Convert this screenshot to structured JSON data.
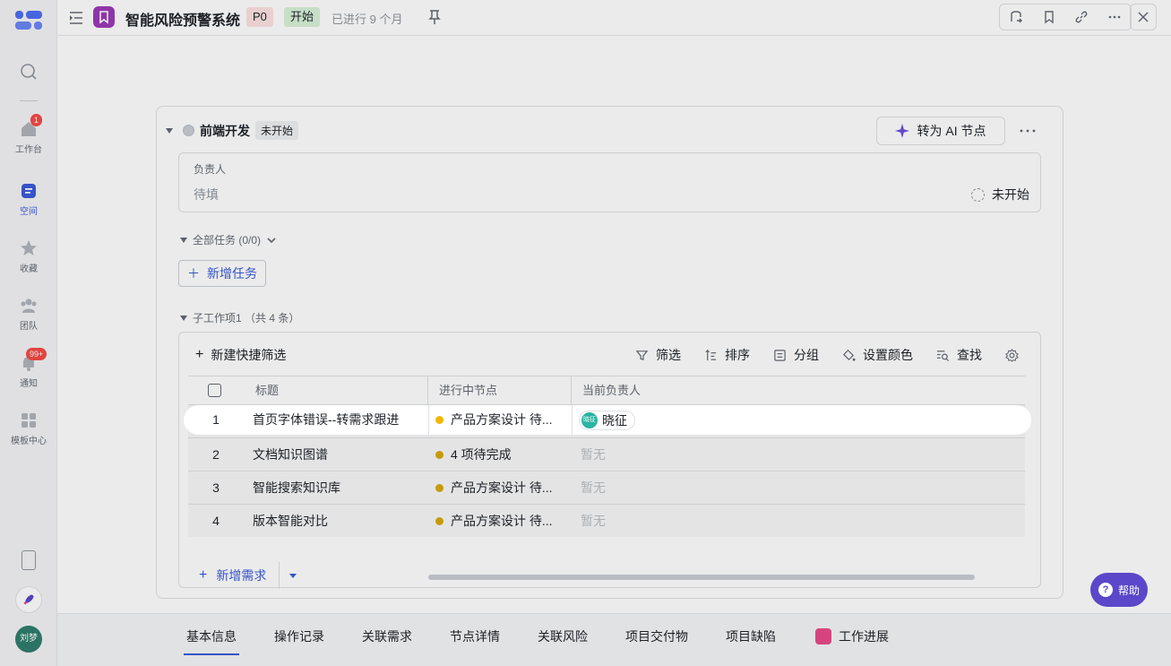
{
  "rail": {
    "items": [
      {
        "label": "工作台",
        "badge": "1"
      },
      {
        "label": "空间"
      },
      {
        "label": "收藏"
      },
      {
        "label": "团队"
      },
      {
        "label": "通知",
        "badge": "99+"
      },
      {
        "label": "模板中心"
      }
    ],
    "user_avatar": "刘梦"
  },
  "header": {
    "title": "智能风险预警系统",
    "priority": "P0",
    "status": "开始",
    "elapsed": "已进行 9 个月"
  },
  "node": {
    "name": "前端开发",
    "status": "未开始",
    "ai_button": "转为 AI 节点",
    "owner_label": "负责人",
    "owner_value": "待填",
    "owner_status": "未开始"
  },
  "tasks": {
    "section_title": "全部任务 (0/0)",
    "add_button": "新增任务"
  },
  "subitems": {
    "section_title": "子工作项1 （共 4 条）",
    "toolbar": {
      "new_filter": "新建快捷筛选",
      "filter": "筛选",
      "sort": "排序",
      "group": "分组",
      "color": "设置颜色",
      "find": "查找"
    },
    "columns": {
      "title": "标题",
      "node": "进行中节点",
      "owner": "当前负责人"
    },
    "rows": [
      {
        "num": "1",
        "title": "首页字体错误--转需求跟进",
        "node": "产品方案设计 待...",
        "owner": "晓征",
        "owner_avatar": "晓征"
      },
      {
        "num": "2",
        "title": "文档知识图谱",
        "node": "4 项待完成",
        "owner": "暂无"
      },
      {
        "num": "3",
        "title": "智能搜索知识库",
        "node": "产品方案设计 待...",
        "owner": "暂无"
      },
      {
        "num": "4",
        "title": "版本智能对比",
        "node": "产品方案设计 待...",
        "owner": "暂无"
      }
    ],
    "add_button": "新增需求"
  },
  "tabs": [
    {
      "label": "基本信息"
    },
    {
      "label": "操作记录"
    },
    {
      "label": "关联需求"
    },
    {
      "label": "节点详情"
    },
    {
      "label": "关联风险"
    },
    {
      "label": "项目交付物"
    },
    {
      "label": "项目缺陷"
    },
    {
      "label": "工作进展"
    }
  ],
  "help": {
    "label": "帮助"
  },
  "colors": {
    "accent": "#3b5bdb",
    "status_dot": "#d7a90c",
    "help_button": "#5b47c9"
  }
}
